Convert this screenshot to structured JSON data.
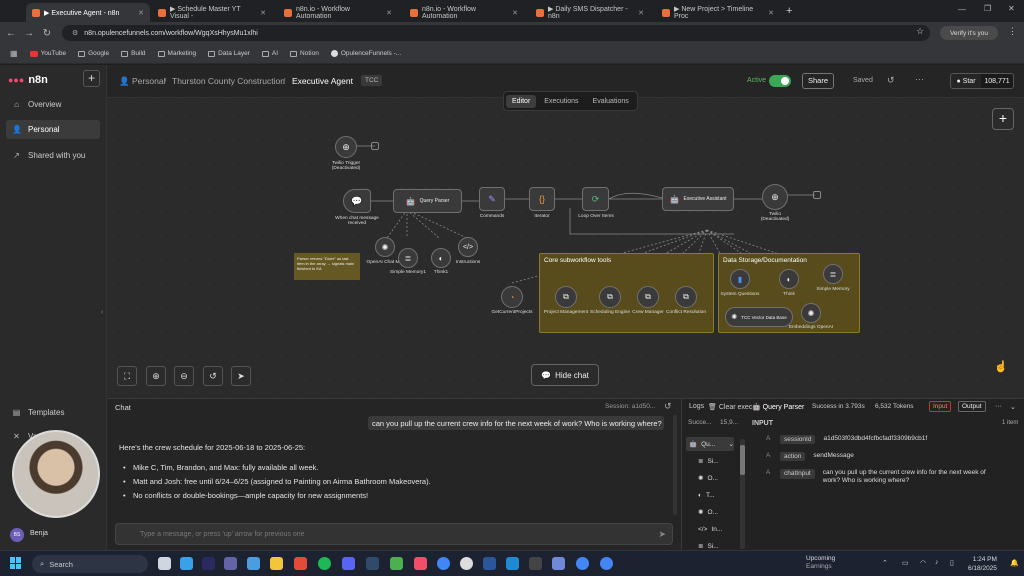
{
  "browser": {
    "tabs": [
      {
        "title": "▶ Executive Agent - n8n",
        "active": true
      },
      {
        "title": "▶ Schedule Master YT Visual -"
      },
      {
        "title": "n8n.io - Workflow Automation"
      },
      {
        "title": "n8n.io - Workflow Automation"
      },
      {
        "title": "▶ Daily SMS Dispatcher - n8n"
      },
      {
        "title": "▶ New Project > Timeline Proc"
      }
    ],
    "url": "n8n.opulencefunnels.com/workflow/WgqXsHhysMu1xlhi",
    "verify_label": "Verify it's you",
    "bookmarks": [
      "YouTube",
      "Google",
      "Build",
      "Marketing",
      "Data Layer",
      "AI",
      "Notion",
      "OpulenceFunnels -..."
    ]
  },
  "app": {
    "logo": "n8n",
    "sidebar": [
      {
        "label": "Overview",
        "icon": "home-icon"
      },
      {
        "label": "Personal",
        "icon": "user-icon",
        "selected": true
      },
      {
        "label": "Shared with you",
        "icon": "share-icon"
      }
    ],
    "sidebar_bottom": [
      {
        "label": "Templates",
        "icon": "templates-icon"
      },
      {
        "label": "Variables",
        "icon": "variables-icon"
      }
    ],
    "user_initials": "BS",
    "user_name": "Benja"
  },
  "header": {
    "breadcrumb_root": "Personal",
    "breadcrumb_folder": "Thurston County Construction",
    "workflow_name": "Executive Agent",
    "tag": "TCC",
    "active_label": "Active",
    "active": true,
    "share_label": "Share",
    "saved_label": "Saved",
    "star_label": "Star",
    "star_count": "108,771"
  },
  "canvas": {
    "view_tabs": [
      "Editor",
      "Executions",
      "Evaluations"
    ],
    "active_tab": "Editor",
    "hide_chat_label": "Hide chat",
    "nodes": {
      "twilio_trigger": "Twilio Trigger (Deactivated)",
      "chat_trigger": "When chat message received",
      "query_parser": "Query Parser",
      "commands": "Commands",
      "iterator": "Iterator",
      "loop": "Loop Over Items",
      "executive": "Executive Assistant",
      "twilio": "Twilio (Deactivated)",
      "openai_chat": "OpenAI Chat M...",
      "simple_memory": "Simple Memory1",
      "think": "Think1",
      "instructions": "Instructions",
      "get_projects": "GetCurrentProjects",
      "project_mgmt": "Project Management",
      "scheduling": "Scheduling Engine",
      "crew_mgr": "Crew Manager",
      "conflict": "Conflict Resolution",
      "system_questions": "System Questions",
      "think2": "Think",
      "simple_memory2": "Simple Memory",
      "vector_store": "TCC Vector Data Base",
      "embeddings": "Embeddings OpenAI"
    },
    "groups": {
      "core": "Core subworkflow tools",
      "storage": "Data Storage/Documentation"
    },
    "note": "Parser returns \"Done\" as last item in the array → signals main finished to EA"
  },
  "chat": {
    "title": "Chat",
    "session": "Session: a1d50...",
    "user_message": "can you pull up the current crew info for the next week of work? Who is working where?",
    "bot_intro": "Here's the crew schedule for 2025-06-18 to 2025-06-25:",
    "bot_items": [
      "Mike C, Tim, Brandon, and Max: fully available all week.",
      "Matt and Josh: free until 6/24–6/25 (assigned to Painting on Airma Bathroom Makeovera).",
      "No conflicts or double-bookings—ample capacity for new assignments!"
    ],
    "input_placeholder": "Type a message, or press 'up' arrow for previous one"
  },
  "logs": {
    "title": "Logs",
    "clear_label": "Clear exec",
    "node_title": "Query Parser",
    "status": "Success in 3.793s",
    "tokens": "6,532 Tokens",
    "input_tab": "Input",
    "output_tab": "Output",
    "input_heading": "INPUT",
    "item_count": "1 item",
    "tree": [
      "Qu...",
      "Si...",
      "O...",
      "T...",
      "O...",
      "In...",
      "Si..."
    ],
    "tree_head": [
      "Succe...",
      "15,9..."
    ],
    "fields": [
      {
        "key": "sessionId",
        "value": "a1d503f03dbd4fcfbcfadf3309b9cb1f"
      },
      {
        "key": "action",
        "value": "sendMessage"
      },
      {
        "key": "chatInput",
        "value": "can you pull up the current crew info for the next week of work? Who is working where?"
      }
    ]
  },
  "taskbar": {
    "search": "Search",
    "weather_title": "Upcoming",
    "weather_sub": "Earnings",
    "time": "1:24 PM",
    "date": "6/18/2025"
  }
}
